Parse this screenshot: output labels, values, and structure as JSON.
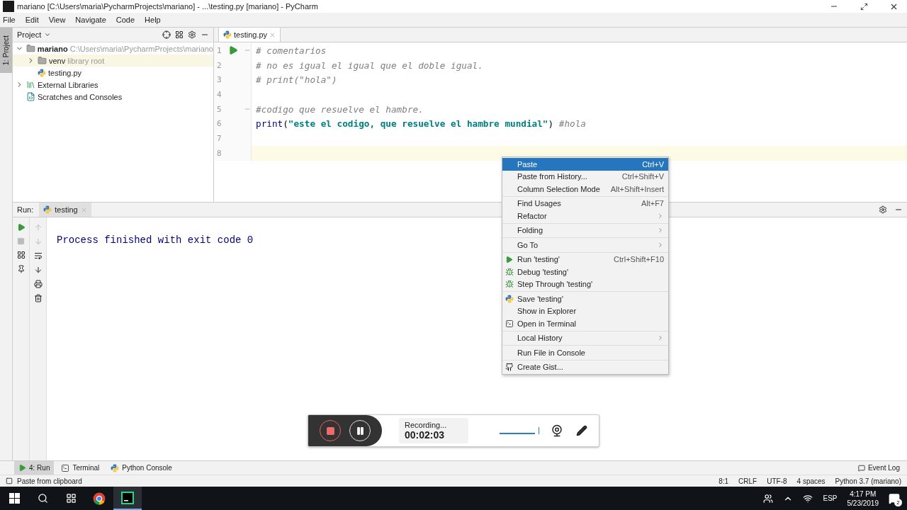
{
  "window": {
    "title": "mariano [C:\\Users\\maria\\PycharmProjects\\mariano] - ...\\testing.py [mariano] - PyCharm"
  },
  "menu": [
    "File",
    "Edit",
    "View",
    "Navigate",
    "Code",
    "Help"
  ],
  "left_stripe": {
    "label": "1: Project"
  },
  "project": {
    "title": "Project",
    "tree": [
      {
        "name": "mariano",
        "hint": "C:\\Users\\maria\\PycharmProjects\\mariano",
        "kind": "folder",
        "expanded": true,
        "children": [
          {
            "name": "venv",
            "hint": "library root",
            "kind": "folder",
            "expanded": false,
            "selected": true
          },
          {
            "name": "testing.py",
            "kind": "python",
            "selected": false
          }
        ]
      },
      {
        "name": "External Libraries",
        "kind": "libraries",
        "expanded": false,
        "selected": false
      },
      {
        "name": "Scratches and Consoles",
        "kind": "scratches",
        "selected": false
      }
    ]
  },
  "editor": {
    "tabs": [
      {
        "label": "testing.py",
        "selected": true
      }
    ],
    "lines": [
      {
        "number": "1",
        "run": true,
        "fold": true,
        "tokens": [
          {
            "kind": "comment",
            "text": "# comentarios"
          }
        ]
      },
      {
        "number": "2",
        "tokens": [
          {
            "kind": "comment",
            "text": "# no es igual el igual que el doble igual."
          }
        ]
      },
      {
        "number": "3",
        "tokens": [
          {
            "kind": "comment",
            "text": "# print(\"hola\")"
          }
        ]
      },
      {
        "number": "4"
      },
      {
        "number": "5",
        "fold": true,
        "tokens": [
          {
            "kind": "comment",
            "text": "#codigo que resuelve el hambre."
          }
        ]
      },
      {
        "number": "6",
        "tokens": [
          {
            "kind": "builtin",
            "text": "print"
          },
          {
            "kind": "plain",
            "text": "("
          },
          {
            "kind": "string",
            "text": "\"este el codigo, que resuelve el hambre mundial\""
          },
          {
            "kind": "plain",
            "text": ") "
          },
          {
            "kind": "comment",
            "text": "#hola"
          }
        ]
      },
      {
        "number": "7"
      },
      {
        "number": "8",
        "current": true
      }
    ]
  },
  "context_menu": {
    "groups": [
      [
        {
          "label": "Paste",
          "shortcut": "Ctrl+V",
          "selected": true
        },
        {
          "label": "Paste from History...",
          "shortcut": "Ctrl+Shift+V",
          "selected": false
        },
        {
          "label": "Column Selection Mode",
          "shortcut": "Alt+Shift+Insert",
          "selected": false
        }
      ],
      [
        {
          "label": "Find Usages",
          "shortcut": "Alt+F7",
          "selected": false
        },
        {
          "label": "Refactor",
          "submenu": true,
          "selected": false
        }
      ],
      [
        {
          "label": "Folding",
          "submenu": true,
          "selected": false
        }
      ],
      [
        {
          "label": "Go To",
          "submenu": true,
          "selected": false
        }
      ],
      [
        {
          "label": "Run 'testing'",
          "shortcut": "Ctrl+Shift+F10",
          "kind": "run",
          "selected": false
        },
        {
          "label": "Debug 'testing'",
          "kind": "debug",
          "selected": false
        },
        {
          "label": "Step Through 'testing'",
          "kind": "debug",
          "selected": false
        }
      ],
      [
        {
          "label": "Save 'testing'",
          "kind": "python",
          "selected": false
        },
        {
          "label": "Show in Explorer",
          "selected": false
        },
        {
          "label": "Open in Terminal",
          "kind": "terminal",
          "selected": false
        }
      ],
      [
        {
          "label": "Local History",
          "submenu": true,
          "selected": false
        }
      ],
      [
        {
          "label": "Run File in Console",
          "selected": false
        }
      ],
      [
        {
          "label": "Create Gist...",
          "kind": "gist",
          "selected": false
        }
      ]
    ]
  },
  "run_panel": {
    "label": "Run:",
    "tabs": [
      {
        "label": "testing",
        "selected": true
      }
    ],
    "output": "Process finished with exit code 0"
  },
  "recorder": {
    "status": "Recording...",
    "time": "00:02:03",
    "level": 0.9
  },
  "tool_tabs": [
    {
      "label": "4: Run",
      "kind": "run",
      "selected": true
    },
    {
      "label": "Terminal",
      "kind": "terminal",
      "selected": false
    },
    {
      "label": "Python Console",
      "kind": "python",
      "selected": false
    }
  ],
  "event_log": "Event Log",
  "status_bar": {
    "message": "Paste from clipboard",
    "items": [
      "8:1",
      "CRLF",
      "UTF-8",
      "4 spaces",
      "Python 3.7 (mariano)"
    ]
  },
  "taskbar": {
    "language": "ESP",
    "time": "4:17 PM",
    "date": "5/23/2019",
    "notifications": "2"
  }
}
